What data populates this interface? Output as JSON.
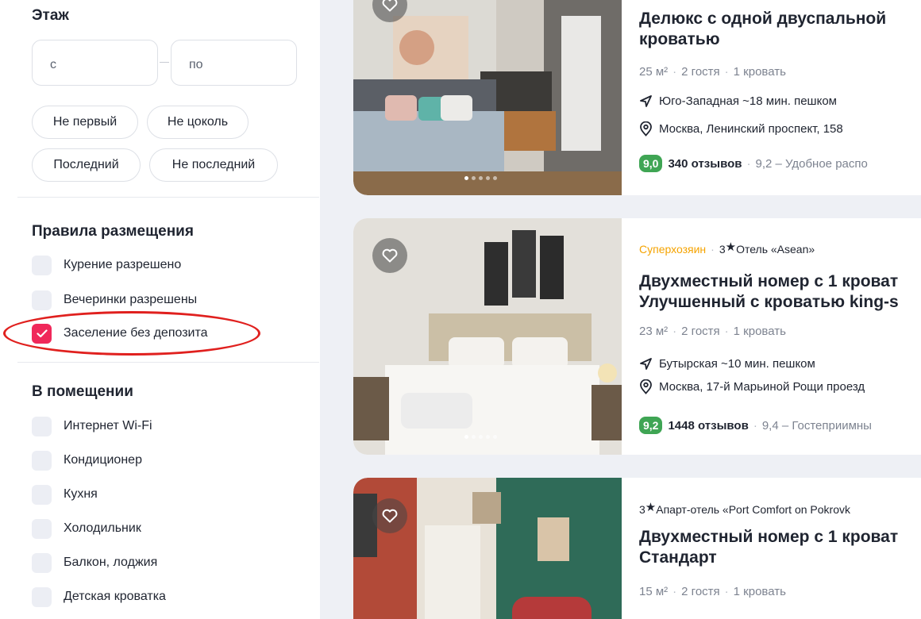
{
  "filters": {
    "floor": {
      "title": "Этаж",
      "from_placeholder": "с",
      "to_placeholder": "по",
      "chips": [
        "Не первый",
        "Не цоколь",
        "Последний",
        "Не последний"
      ]
    },
    "rules": {
      "title": "Правила размещения",
      "items": [
        {
          "label": "Курение разрешено",
          "checked": false
        },
        {
          "label": "Вечеринки разрешены",
          "checked": false
        },
        {
          "label": "Заселение без депозита",
          "checked": true
        }
      ]
    },
    "room": {
      "title": "В помещении",
      "items": [
        {
          "label": "Интернет Wi-Fi",
          "checked": false
        },
        {
          "label": "Кондиционер",
          "checked": false
        },
        {
          "label": "Кухня",
          "checked": false
        },
        {
          "label": "Холодильник",
          "checked": false
        },
        {
          "label": "Балкон, лоджия",
          "checked": false
        },
        {
          "label": "Детская кроватка",
          "checked": false
        }
      ]
    }
  },
  "listings": [
    {
      "title_line1": "Делюкс с одной двуспальной",
      "title_line2": "кроватью",
      "meta": {
        "area": "25 м²",
        "guests": "2 гостя",
        "beds": "1 кровать"
      },
      "metro": "Юго-Западная ~18 мин. пешком",
      "address": "Москва, Ленинский проспект, 158",
      "rating": {
        "score": "9,0",
        "reviews": "340 отзывов",
        "text": "9,2 – Удобное распо"
      },
      "photo_count": 5,
      "active_photo": 1
    },
    {
      "superhost": "Суперхозяин",
      "stars": "3",
      "property": "Отель «Asean»",
      "title_line1": "Двухместный номер с 1 кроват",
      "title_line2": "Улучшенный с кроватью king-s",
      "meta": {
        "area": "23 м²",
        "guests": "2 гостя",
        "beds": "1 кровать"
      },
      "metro": "Бутырская ~10 мин. пешком",
      "address": "Москва, 17-й Марьиной Рощи проезд",
      "rating": {
        "score": "9,2",
        "reviews": "1448 отзывов",
        "text": "9,4 – Гостеприимны"
      },
      "photo_count": 5,
      "active_photo": 1
    },
    {
      "stars": "3",
      "property": "Апарт-отель «Port Comfort on Pokrovk",
      "title_line1": "Двухместный номер с 1 кроват",
      "title_line2": "Стандарт",
      "meta": {
        "area": "15 м²",
        "guests": "2 гостя",
        "beds": "1 кровать"
      }
    }
  ],
  "colors": {
    "accent": "#f0285a",
    "rating": "#3fa554",
    "superhost": "#f5a300",
    "annotation": "#e0201e"
  }
}
